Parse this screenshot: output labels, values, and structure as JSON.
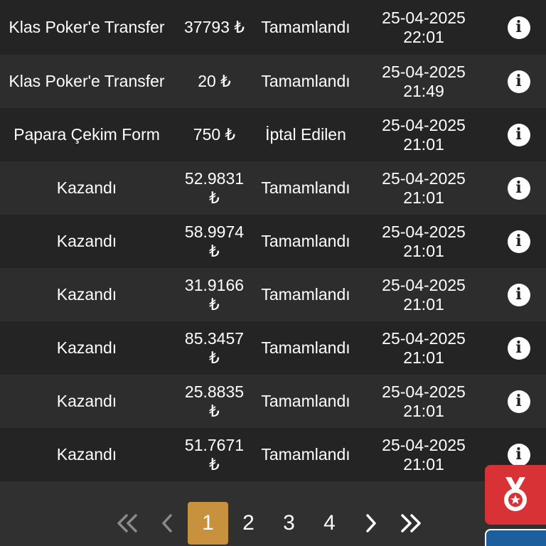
{
  "transactions": [
    {
      "description": "Klas Poker'e Transfer",
      "amount": "37793 ₺",
      "amount_cur": "",
      "status": "Tamamlandı",
      "date": "25-04-2025",
      "time": "22:01"
    },
    {
      "description": "Klas Poker'e Transfer",
      "amount": "20 ₺",
      "amount_cur": "",
      "status": "Tamamlandı",
      "date": "25-04-2025",
      "time": "21:49"
    },
    {
      "description": "Papara Çekim Form",
      "amount": "750 ₺",
      "amount_cur": "",
      "status": "İptal Edilen",
      "date": "25-04-2025",
      "time": "21:01"
    },
    {
      "description": "Kazandı",
      "amount": "52.9831",
      "amount_cur": "₺",
      "status": "Tamamlandı",
      "date": "25-04-2025",
      "time": "21:01"
    },
    {
      "description": "Kazandı",
      "amount": "58.9974",
      "amount_cur": "₺",
      "status": "Tamamlandı",
      "date": "25-04-2025",
      "time": "21:01"
    },
    {
      "description": "Kazandı",
      "amount": "31.9166",
      "amount_cur": "₺",
      "status": "Tamamlandı",
      "date": "25-04-2025",
      "time": "21:01"
    },
    {
      "description": "Kazandı",
      "amount": "85.3457",
      "amount_cur": "₺",
      "status": "Tamamlandı",
      "date": "25-04-2025",
      "time": "21:01"
    },
    {
      "description": "Kazandı",
      "amount": "25.8835",
      "amount_cur": "₺",
      "status": "Tamamlandı",
      "date": "25-04-2025",
      "time": "21:01"
    },
    {
      "description": "Kazandı",
      "amount": "51.7671",
      "amount_cur": "₺",
      "status": "Tamamlandı",
      "date": "25-04-2025",
      "time": "21:01"
    }
  ],
  "info_icon": "info-icon",
  "pagination": {
    "first": "«",
    "prev": "‹",
    "pages": [
      "1",
      "2",
      "3",
      "4"
    ],
    "active_page": "1",
    "next": "›",
    "last": "»"
  },
  "colors": {
    "accent": "#c8913e",
    "badge": "#d83236",
    "badge_secondary": "#1d5f9e"
  },
  "side_badge": {
    "icon": "medal-icon"
  }
}
